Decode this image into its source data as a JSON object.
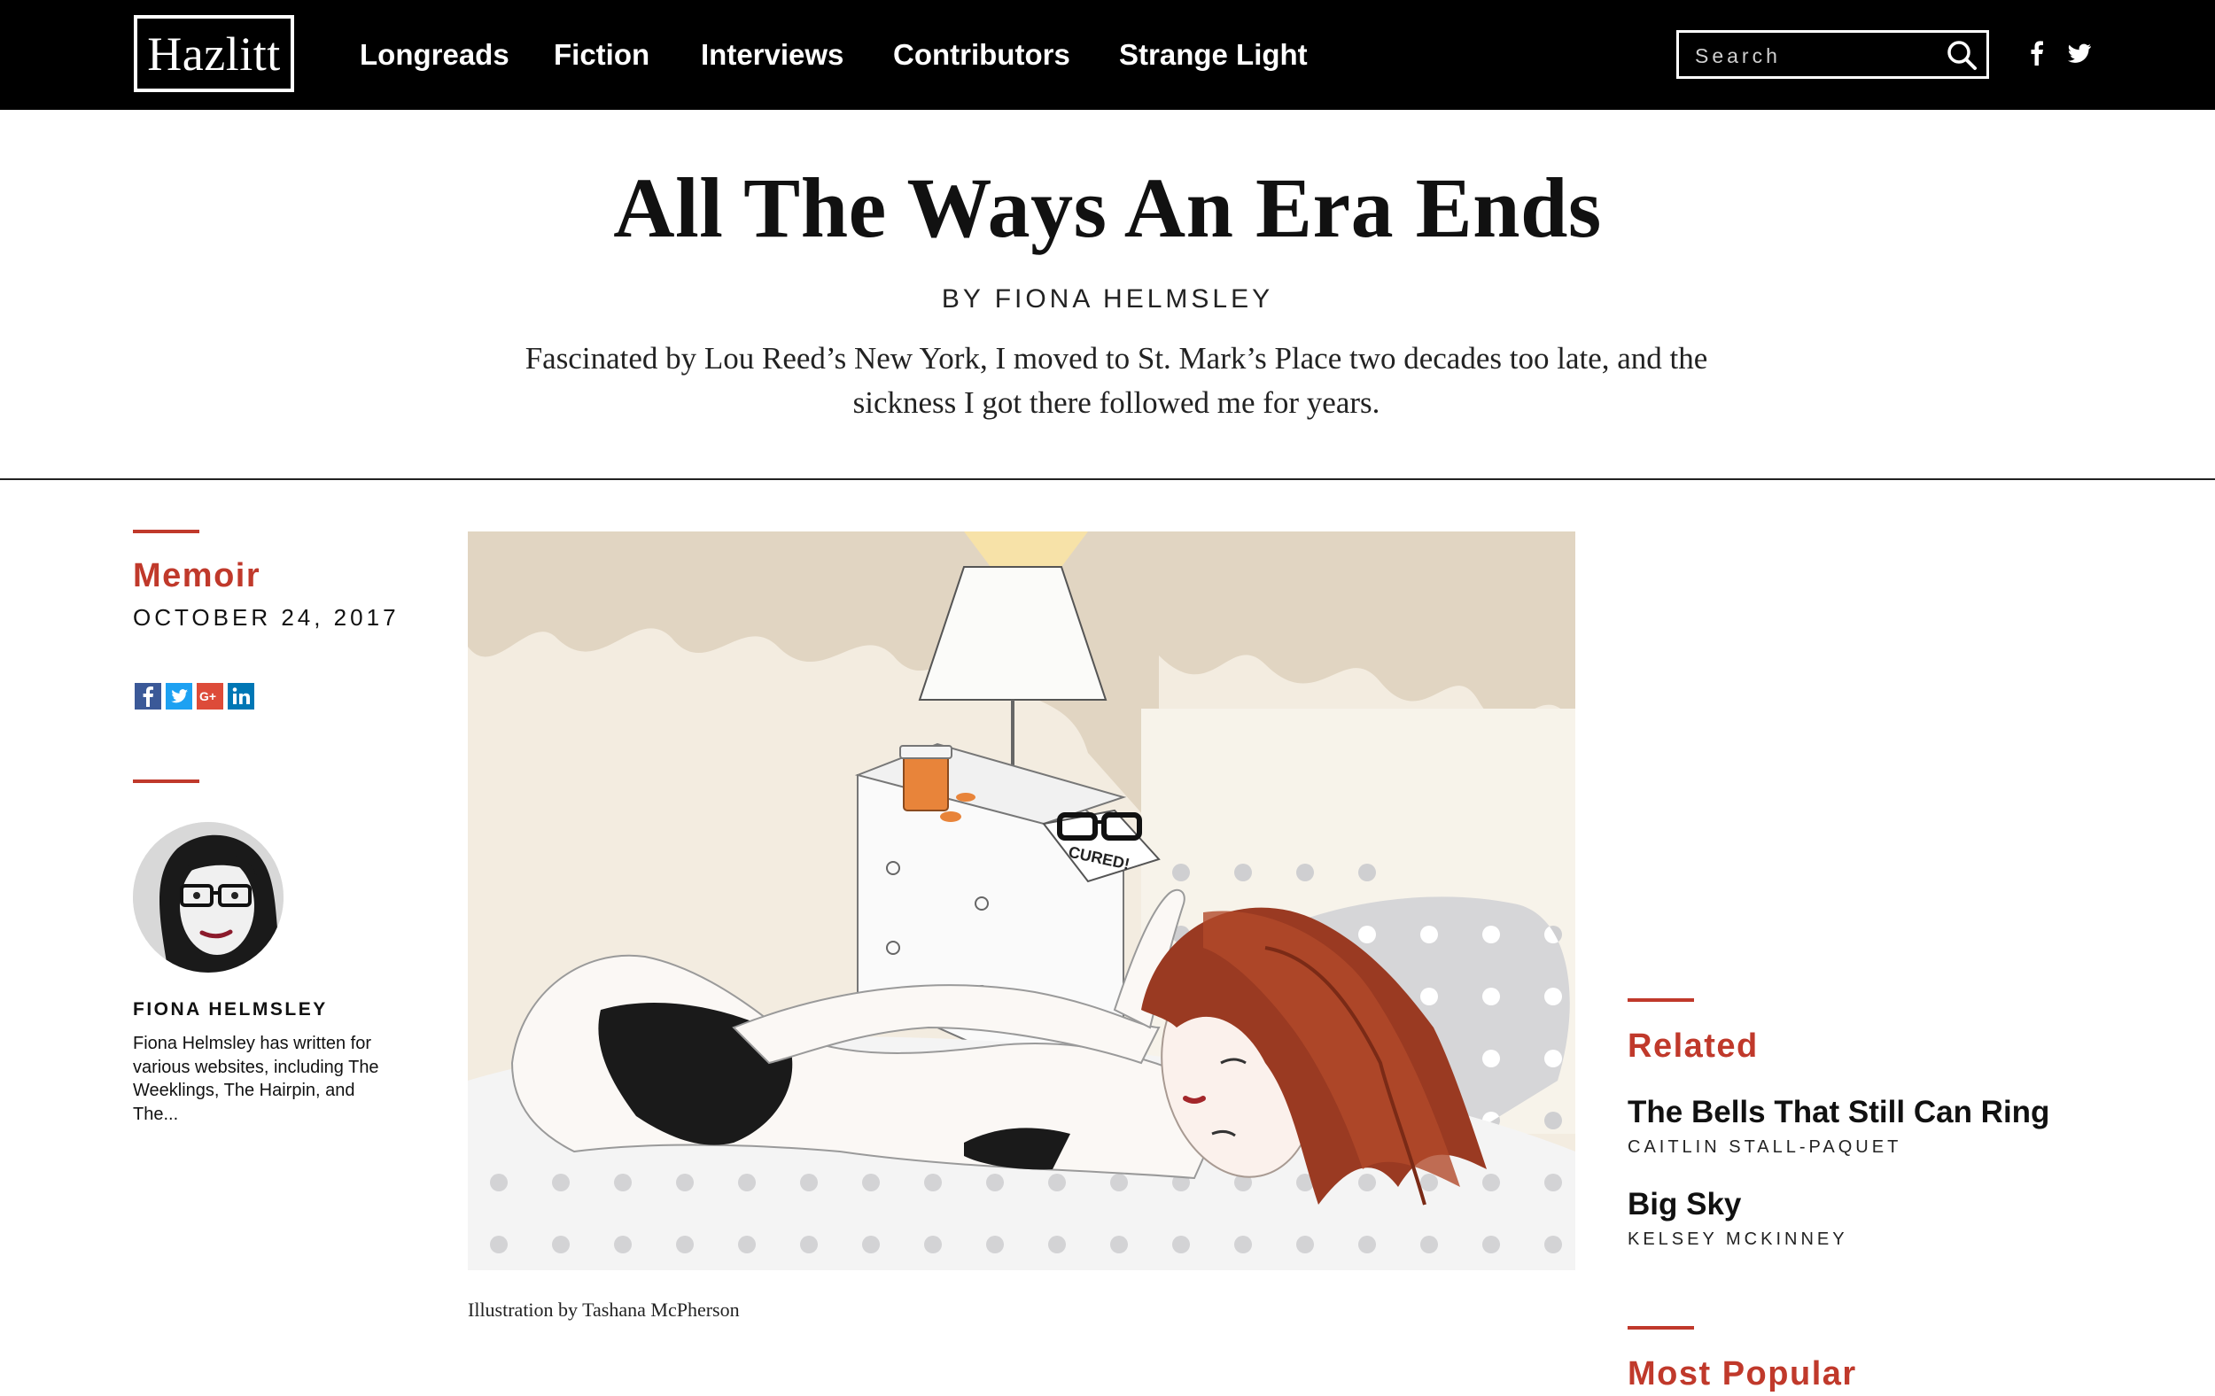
{
  "site": {
    "logo_text": "Hazlitt",
    "nav": [
      {
        "label": "Longreads"
      },
      {
        "label": "Fiction"
      },
      {
        "label": "Interviews"
      },
      {
        "label": "Contributors"
      },
      {
        "label": "Strange Light"
      }
    ],
    "search": {
      "placeholder": "Search"
    },
    "social": [
      "facebook-icon",
      "twitter-icon"
    ]
  },
  "article": {
    "title": "All The Ways An Era Ends",
    "byline": "BY FIONA HELMSLEY",
    "dek": "Fascinated by Lou Reed’s New York, I moved to St. Mark’s Place two decades too late, and the sickness I got there followed me for years.",
    "category": "Memoir",
    "date": "OCTOBER 24, 2017",
    "share_icons": [
      "facebook-icon",
      "twitter-icon",
      "google-plus-icon",
      "linkedin-icon"
    ],
    "illustration_label": "CURED!",
    "caption": "Illustration by Tashana McPherson"
  },
  "author": {
    "name": "FIONA HELMSLEY",
    "bio": "Fiona Helmsley has written for various websites, including The Weeklings, The Hairpin, and The..."
  },
  "sidebar": {
    "related_heading": "Related",
    "related": [
      {
        "title": "The Bells That Still Can Ring",
        "author": "CAITLIN STALL-PAQUET"
      },
      {
        "title": "Big Sky",
        "author": "KELSEY MCKINNEY"
      }
    ],
    "most_popular_heading": "Most Popular"
  },
  "colors": {
    "accent": "#c0392b",
    "topbar": "#000000"
  }
}
